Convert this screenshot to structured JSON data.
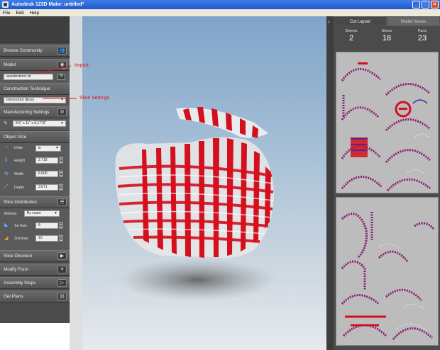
{
  "window": {
    "title": "Autodesk 123D Make: untitled*"
  },
  "menu": [
    "File",
    "Edit",
    "Help"
  ],
  "left_panel": {
    "browse": {
      "label": "Browse Community"
    },
    "model": {
      "label": "Model",
      "file": "autodeskmcl.stl"
    },
    "construction": {
      "label": "Construction Technique",
      "value": "Interlocked Slices"
    },
    "manufacturing": {
      "label": "Manufacturing Settings",
      "value": "8.5\" x 11\" x 0.1772\""
    },
    "object_size": {
      "label": "Object Size",
      "units_label": "Units",
      "units_value": "in",
      "height_label": "Height",
      "height_value": "2.718",
      "width_label": "Width",
      "width_value": "6.000",
      "depth_label": "Depth",
      "depth_value": "3.071"
    },
    "slice_distribution": {
      "label": "Slice Distribution",
      "method_label": "Method",
      "method_value": "By count",
      "axis1_label": "1st Axis",
      "axis1_value": "8",
      "axis2_label": "2nd Axis",
      "axis2_value": "10"
    },
    "slice_direction": {
      "label": "Slice Direction"
    },
    "modify_form": {
      "label": "Modify Form"
    },
    "assembly_steps": {
      "label": "Assembly Steps"
    },
    "get_plans": {
      "label": "Get Plans"
    }
  },
  "annotations": {
    "import": "Import",
    "slice_settings": "Slice Settings"
  },
  "right_panel": {
    "tabs": [
      {
        "label": "Cut Layout"
      },
      {
        "label": "Model Issues"
      }
    ],
    "stats": [
      {
        "label": "Sheets",
        "value": "2"
      },
      {
        "label": "Slices",
        "value": "18"
      },
      {
        "label": "Parts",
        "value": "23"
      }
    ]
  },
  "colors": {
    "slice_red": "#d4101e",
    "slice_white": "#f4f4f4",
    "panel": "#4b4b4b",
    "title_blue": "#2a63d6",
    "annotation": "#e0101e"
  }
}
